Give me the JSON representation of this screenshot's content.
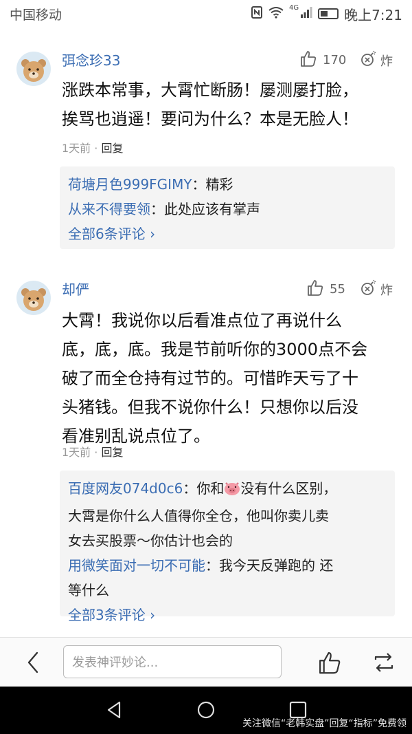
{
  "status_bar": {
    "carrier": "中国移动",
    "network": "4G",
    "time": "晚上7:21"
  },
  "comments": [
    {
      "author": "弭念珍33",
      "likes": "170",
      "bomb_label": "炸",
      "body_lines": [
        "涨跌本常事，大霄忙断肠！屡测屡打脸，",
        "挨骂也逍遥！要问为什么？本是无脸人！"
      ],
      "time": "1天前",
      "separator": "·",
      "reply_label": "回复",
      "replies": [
        {
          "user": "荷塘月色999FGIMY",
          "sep": "：",
          "text": "精彩"
        },
        {
          "user": "从来不得要领",
          "sep": "：",
          "text": "此处应该有掌声"
        }
      ],
      "more": "全部6条评论 ›"
    },
    {
      "author": "却俨",
      "likes": "55",
      "bomb_label": "炸",
      "body_lines": [
        "大霄！我说你以后看准点位了再说什么",
        "底，底，底。我是节前听你的3000点不会",
        "破了而全仓持有过节的。可惜昨天亏了十",
        "头猪钱。但我不说你什么！只想你以后没",
        "看准别乱说点位了。"
      ],
      "time": "1天前",
      "separator": "·",
      "reply_label": "回复",
      "replies": [
        {
          "user": "百度网友074d0c6",
          "sep": "：",
          "text_before": "你和",
          "emoji": "pig-emoji",
          "text_lines": [
            "没有什么区别，",
            "大霄是你什么人值得你全仓，他叫你卖儿卖",
            "女去买股票～你估计也会的"
          ]
        },
        {
          "user": "用微笑面对一切不可能",
          "sep": "：",
          "text_lines": [
            "我今天反弹跑的 还",
            "等什么"
          ]
        }
      ],
      "more": "全部3条评论 ›"
    }
  ],
  "bottom_bar": {
    "input_placeholder": "发表神评妙论..."
  },
  "watermark": "关注微信“老韩实盘”回复“指标”免费领",
  "colors": {
    "link_blue": "#3b6db3",
    "reply_bg": "#f4f4f4",
    "nav_bg": "#000000"
  }
}
